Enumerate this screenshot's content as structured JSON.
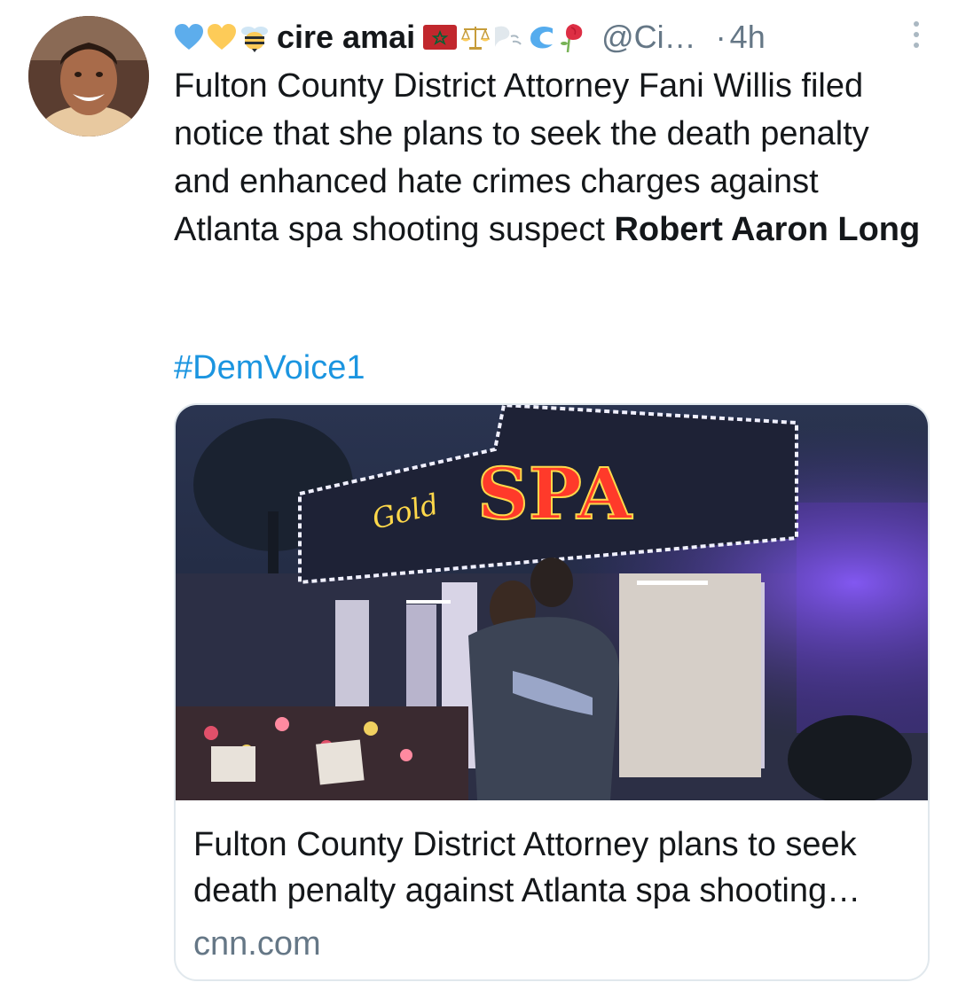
{
  "user": {
    "display_name": "cire amai",
    "handle": "@Ci…",
    "time_separator": "·",
    "time": "4h",
    "name_emojis_before": [
      "blue-heart-icon",
      "yellow-heart-icon",
      "bee-icon"
    ],
    "name_emojis_after": [
      "morocco-flag-icon",
      "scales-icon",
      "wind-icon",
      "wave-icon",
      "rose-icon"
    ]
  },
  "tweet": {
    "text_plain": "Fulton County District Attorney Fani Willis filed notice that she plans to seek the death penalty and enhanced hate crimes charges against Atlanta spa shooting suspect ",
    "text_bold": "Robert Aaron Long",
    "hashtag": "#DemVoice1"
  },
  "card": {
    "image_sign_script": "Gold",
    "image_sign_main": "SPA",
    "title": "Fulton County District Attorney plans to seek death penalty against Atlanta spa shooting…",
    "domain": "cnn.com"
  },
  "colors": {
    "link": "#1b95e0",
    "secondary_text": "#657786",
    "card_border": "#e1e8ed",
    "neon_red": "#ff2a2a",
    "neon_purple": "#7b3fe4"
  }
}
